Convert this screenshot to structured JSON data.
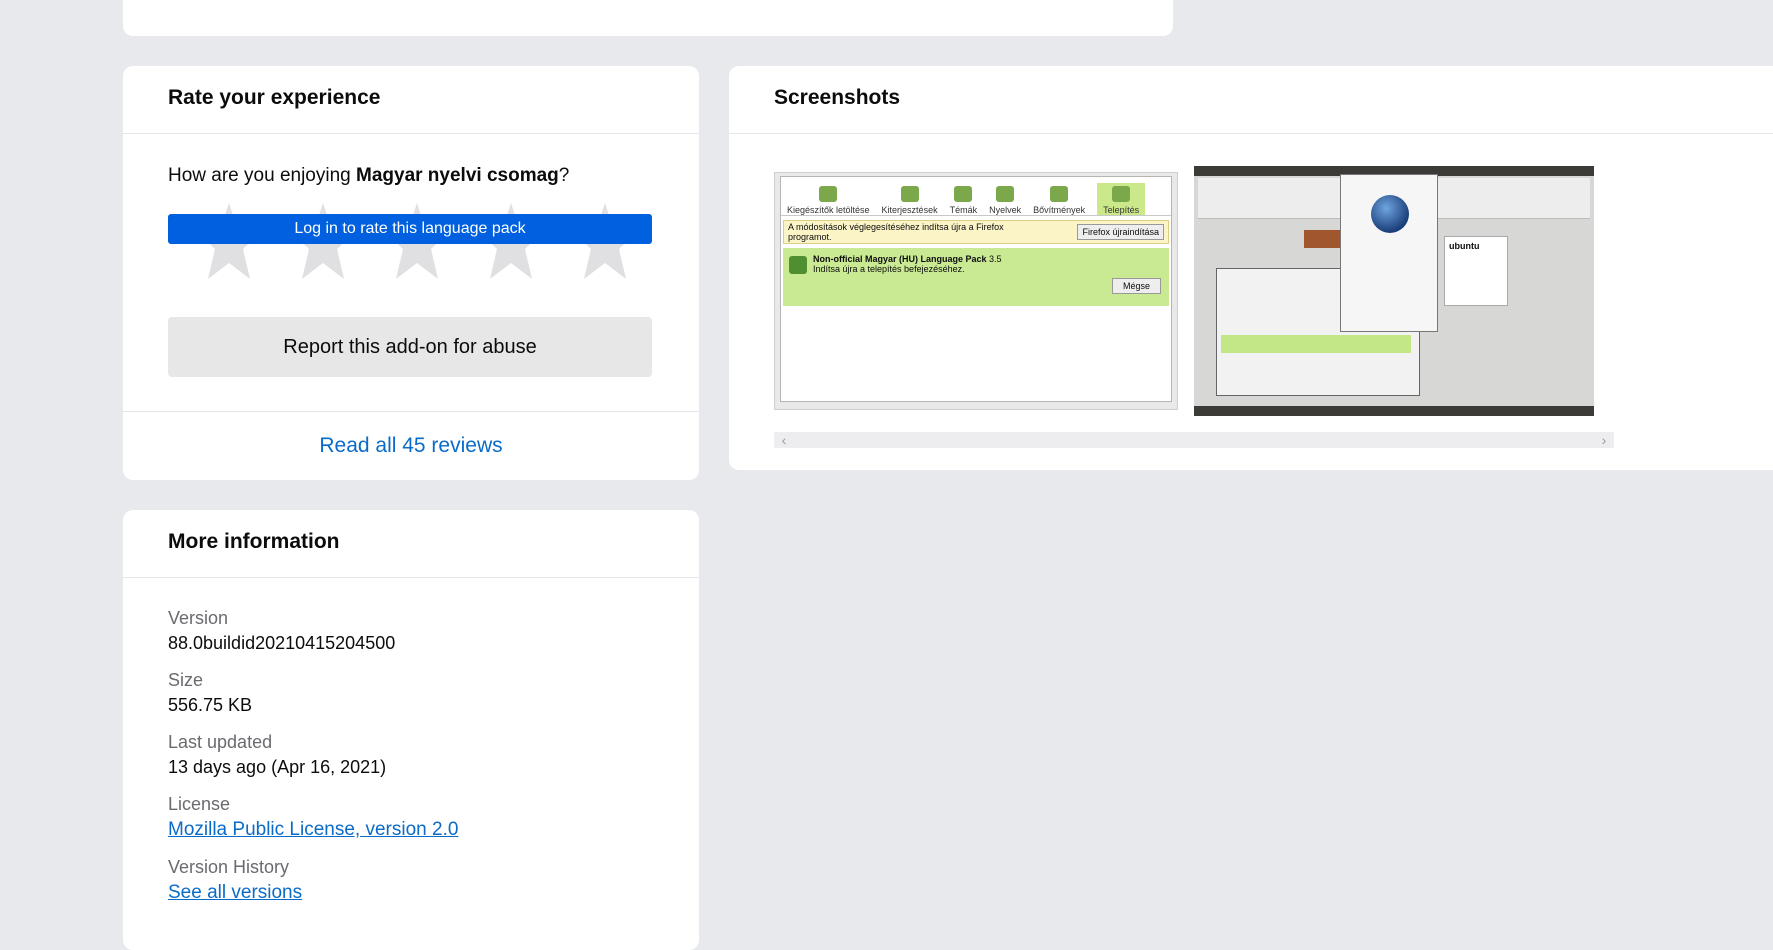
{
  "rate": {
    "title": "Rate your experience",
    "question_prefix": "How are you enjoying ",
    "addon_name": "Magyar nyelvi csomag",
    "question_suffix": "?",
    "login_label": "Log in to rate this language pack",
    "report_label": "Report this add-on for abuse",
    "read_reviews": "Read all 45 reviews"
  },
  "screenshots": {
    "title": "Screenshots",
    "shot1": {
      "toolbar": [
        "Kiegészítők letöltése",
        "Kiterjesztések",
        "Témák",
        "Nyelvek",
        "Bővítmények",
        "Telepítés"
      ],
      "infobar": "A módosítások véglegesítéséhez indítsa újra a Firefox programot.",
      "restart": "Firefox újraindítása",
      "pack_name": "Non-official Magyar (HU) Language Pack",
      "pack_version": "3.5",
      "pack_note": "Indítsa újra a telepítés befejezéséhez.",
      "cancel": "Mégse"
    },
    "shot2": {
      "ubuntu": "ubuntu"
    }
  },
  "info": {
    "title": "More information",
    "version_label": "Version",
    "version_value": "88.0buildid20210415204500",
    "size_label": "Size",
    "size_value": "556.75 KB",
    "updated_label": "Last updated",
    "updated_value": "13 days ago (Apr 16, 2021)",
    "license_label": "License",
    "license_value": "Mozilla Public License, version 2.0",
    "history_label": "Version History",
    "history_value": "See all versions"
  },
  "colors": {
    "accent": "#0060df",
    "link": "#0a6bc9",
    "page_bg": "#e7e9ec"
  }
}
